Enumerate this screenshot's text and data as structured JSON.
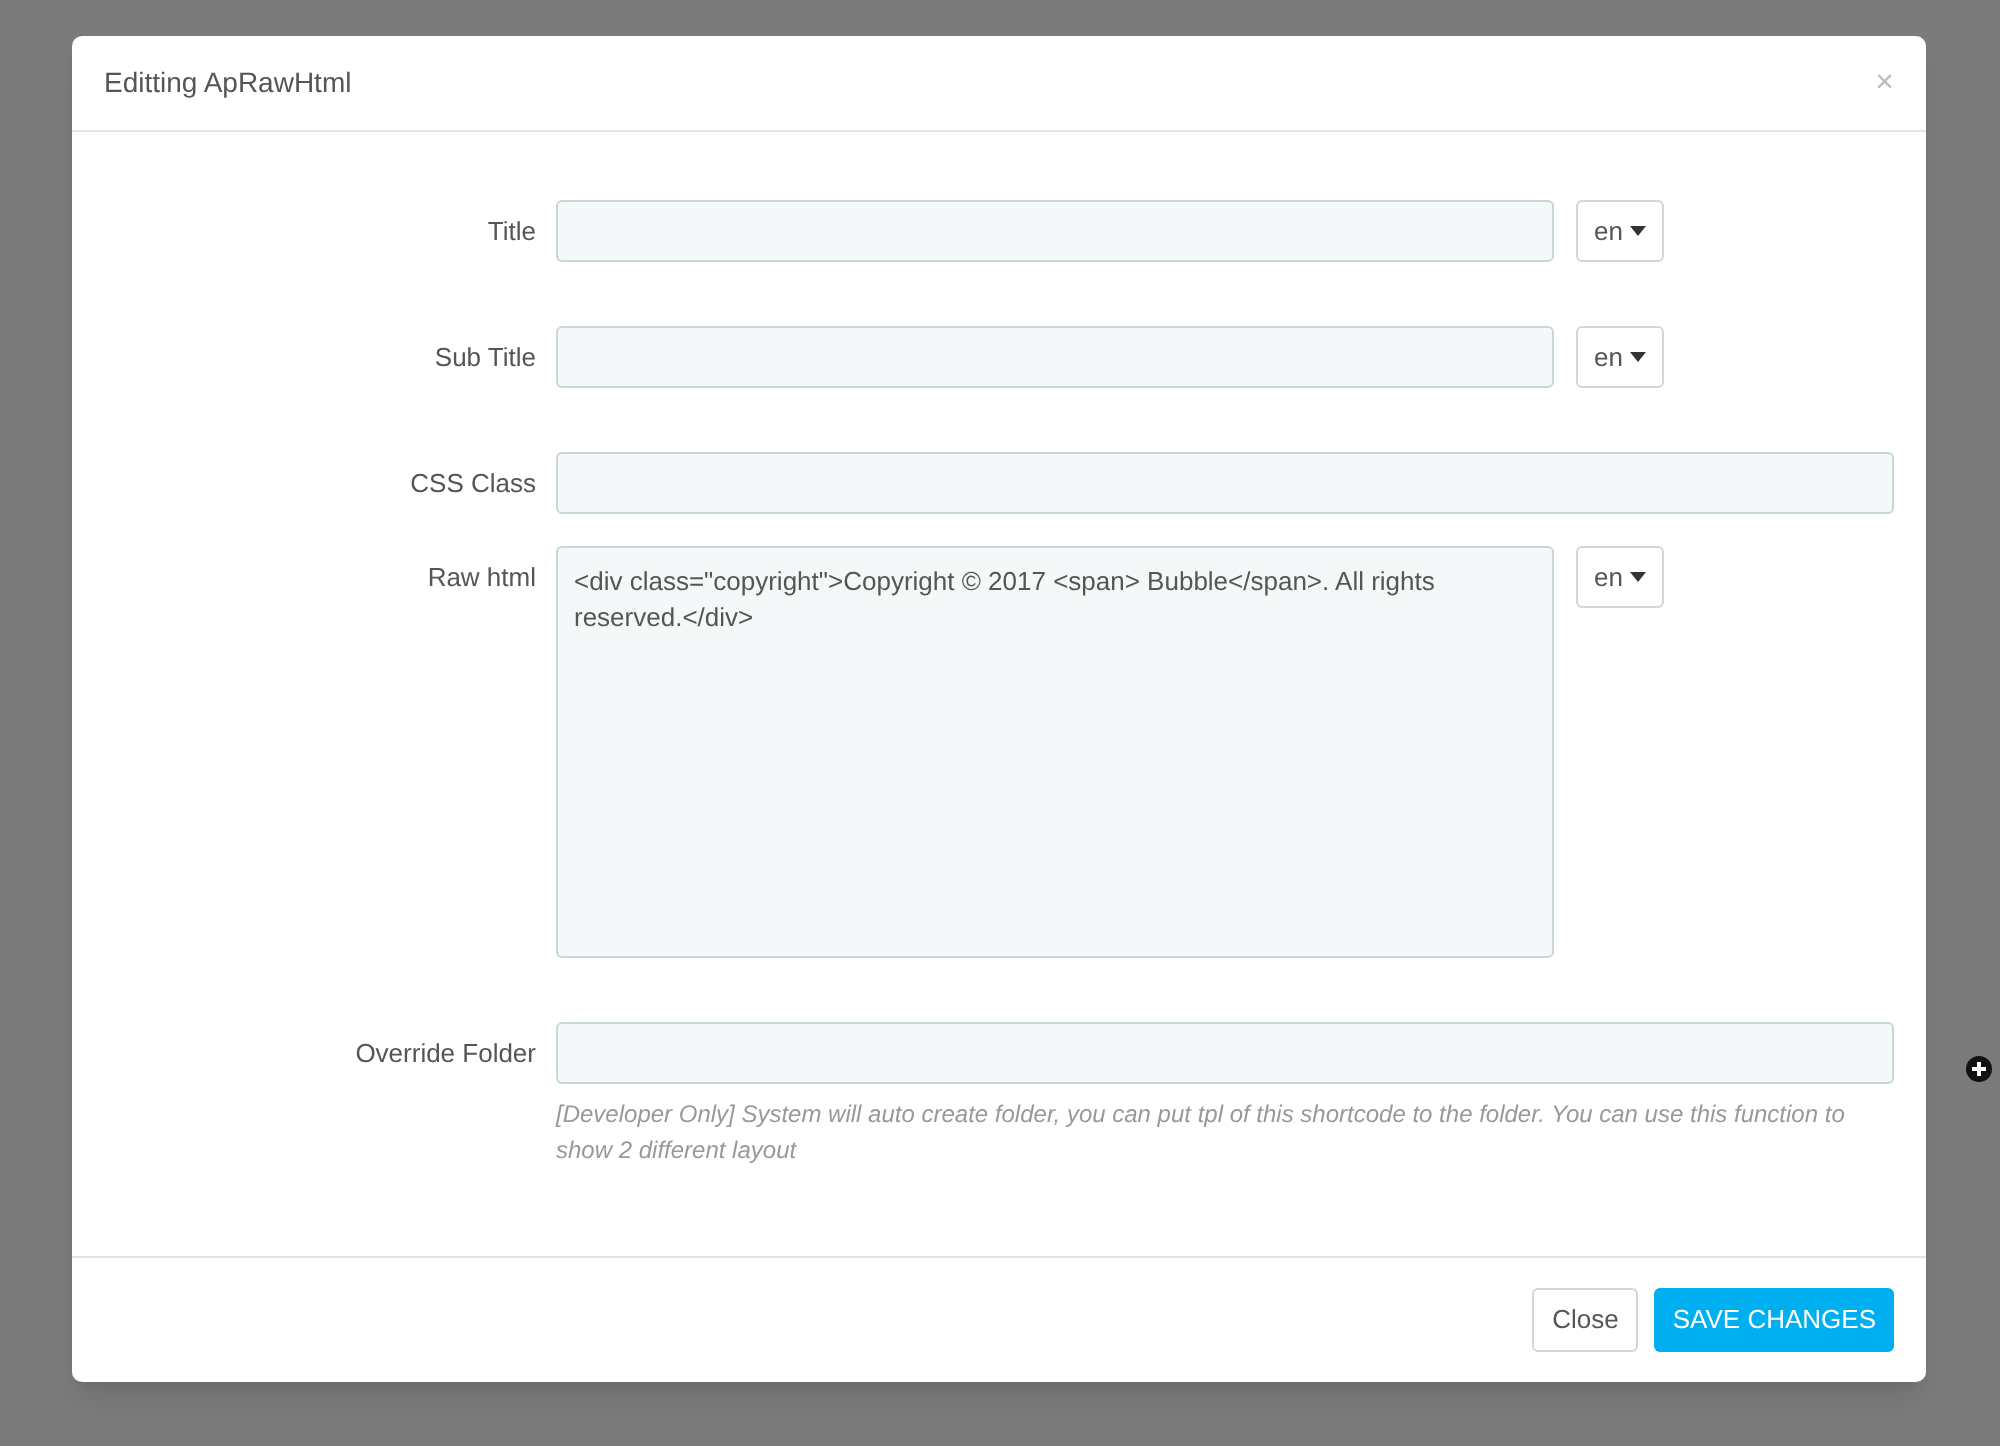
{
  "modal": {
    "title": "Editting ApRawHtml",
    "close": "×"
  },
  "fields": [
    {
      "kind": "text",
      "label": "Title",
      "lang": "en"
    },
    {
      "kind": "text",
      "label": "Sub Title",
      "lang": "en"
    },
    {
      "kind": "text",
      "label": "CSS Class"
    },
    {
      "kind": "textarea",
      "label": "Raw html",
      "value": "<div class=\"copyright\">Copyright © 2017 <span> Bubble</span>. All rights reserved.</div>",
      "lang": "en"
    },
    {
      "kind": "text",
      "label": "Override Folder",
      "help": "[Developer Only] System will auto create folder, you can put tpl of this shortcode to the folder. You can use this function to show 2 different layout"
    }
  ],
  "buttons": [
    {
      "label": "Close",
      "kind": "default"
    },
    {
      "label": "SAVE CHANGES",
      "kind": "primary"
    }
  ]
}
